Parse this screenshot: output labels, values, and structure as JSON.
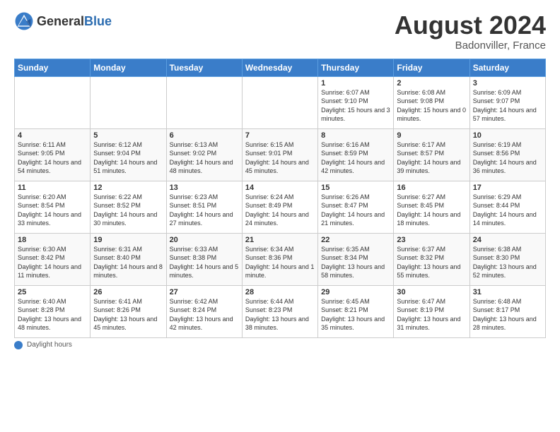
{
  "logo": {
    "general": "General",
    "blue": "Blue"
  },
  "title": "August 2024",
  "location": "Badonviller, France",
  "days_of_week": [
    "Sunday",
    "Monday",
    "Tuesday",
    "Wednesday",
    "Thursday",
    "Friday",
    "Saturday"
  ],
  "footer": {
    "label": "Daylight hours"
  },
  "weeks": [
    [
      {
        "day": "",
        "info": ""
      },
      {
        "day": "",
        "info": ""
      },
      {
        "day": "",
        "info": ""
      },
      {
        "day": "",
        "info": ""
      },
      {
        "day": "1",
        "info": "Sunrise: 6:07 AM\nSunset: 9:10 PM\nDaylight: 15 hours\nand 3 minutes."
      },
      {
        "day": "2",
        "info": "Sunrise: 6:08 AM\nSunset: 9:08 PM\nDaylight: 15 hours\nand 0 minutes."
      },
      {
        "day": "3",
        "info": "Sunrise: 6:09 AM\nSunset: 9:07 PM\nDaylight: 14 hours\nand 57 minutes."
      }
    ],
    [
      {
        "day": "4",
        "info": "Sunrise: 6:11 AM\nSunset: 9:05 PM\nDaylight: 14 hours\nand 54 minutes."
      },
      {
        "day": "5",
        "info": "Sunrise: 6:12 AM\nSunset: 9:04 PM\nDaylight: 14 hours\nand 51 minutes."
      },
      {
        "day": "6",
        "info": "Sunrise: 6:13 AM\nSunset: 9:02 PM\nDaylight: 14 hours\nand 48 minutes."
      },
      {
        "day": "7",
        "info": "Sunrise: 6:15 AM\nSunset: 9:01 PM\nDaylight: 14 hours\nand 45 minutes."
      },
      {
        "day": "8",
        "info": "Sunrise: 6:16 AM\nSunset: 8:59 PM\nDaylight: 14 hours\nand 42 minutes."
      },
      {
        "day": "9",
        "info": "Sunrise: 6:17 AM\nSunset: 8:57 PM\nDaylight: 14 hours\nand 39 minutes."
      },
      {
        "day": "10",
        "info": "Sunrise: 6:19 AM\nSunset: 8:56 PM\nDaylight: 14 hours\nand 36 minutes."
      }
    ],
    [
      {
        "day": "11",
        "info": "Sunrise: 6:20 AM\nSunset: 8:54 PM\nDaylight: 14 hours\nand 33 minutes."
      },
      {
        "day": "12",
        "info": "Sunrise: 6:22 AM\nSunset: 8:52 PM\nDaylight: 14 hours\nand 30 minutes."
      },
      {
        "day": "13",
        "info": "Sunrise: 6:23 AM\nSunset: 8:51 PM\nDaylight: 14 hours\nand 27 minutes."
      },
      {
        "day": "14",
        "info": "Sunrise: 6:24 AM\nSunset: 8:49 PM\nDaylight: 14 hours\nand 24 minutes."
      },
      {
        "day": "15",
        "info": "Sunrise: 6:26 AM\nSunset: 8:47 PM\nDaylight: 14 hours\nand 21 minutes."
      },
      {
        "day": "16",
        "info": "Sunrise: 6:27 AM\nSunset: 8:45 PM\nDaylight: 14 hours\nand 18 minutes."
      },
      {
        "day": "17",
        "info": "Sunrise: 6:29 AM\nSunset: 8:44 PM\nDaylight: 14 hours\nand 14 minutes."
      }
    ],
    [
      {
        "day": "18",
        "info": "Sunrise: 6:30 AM\nSunset: 8:42 PM\nDaylight: 14 hours\nand 11 minutes."
      },
      {
        "day": "19",
        "info": "Sunrise: 6:31 AM\nSunset: 8:40 PM\nDaylight: 14 hours\nand 8 minutes."
      },
      {
        "day": "20",
        "info": "Sunrise: 6:33 AM\nSunset: 8:38 PM\nDaylight: 14 hours\nand 5 minutes."
      },
      {
        "day": "21",
        "info": "Sunrise: 6:34 AM\nSunset: 8:36 PM\nDaylight: 14 hours\nand 1 minute."
      },
      {
        "day": "22",
        "info": "Sunrise: 6:35 AM\nSunset: 8:34 PM\nDaylight: 13 hours\nand 58 minutes."
      },
      {
        "day": "23",
        "info": "Sunrise: 6:37 AM\nSunset: 8:32 PM\nDaylight: 13 hours\nand 55 minutes."
      },
      {
        "day": "24",
        "info": "Sunrise: 6:38 AM\nSunset: 8:30 PM\nDaylight: 13 hours\nand 52 minutes."
      }
    ],
    [
      {
        "day": "25",
        "info": "Sunrise: 6:40 AM\nSunset: 8:28 PM\nDaylight: 13 hours\nand 48 minutes."
      },
      {
        "day": "26",
        "info": "Sunrise: 6:41 AM\nSunset: 8:26 PM\nDaylight: 13 hours\nand 45 minutes."
      },
      {
        "day": "27",
        "info": "Sunrise: 6:42 AM\nSunset: 8:24 PM\nDaylight: 13 hours\nand 42 minutes."
      },
      {
        "day": "28",
        "info": "Sunrise: 6:44 AM\nSunset: 8:23 PM\nDaylight: 13 hours\nand 38 minutes."
      },
      {
        "day": "29",
        "info": "Sunrise: 6:45 AM\nSunset: 8:21 PM\nDaylight: 13 hours\nand 35 minutes."
      },
      {
        "day": "30",
        "info": "Sunrise: 6:47 AM\nSunset: 8:19 PM\nDaylight: 13 hours\nand 31 minutes."
      },
      {
        "day": "31",
        "info": "Sunrise: 6:48 AM\nSunset: 8:17 PM\nDaylight: 13 hours\nand 28 minutes."
      }
    ]
  ]
}
